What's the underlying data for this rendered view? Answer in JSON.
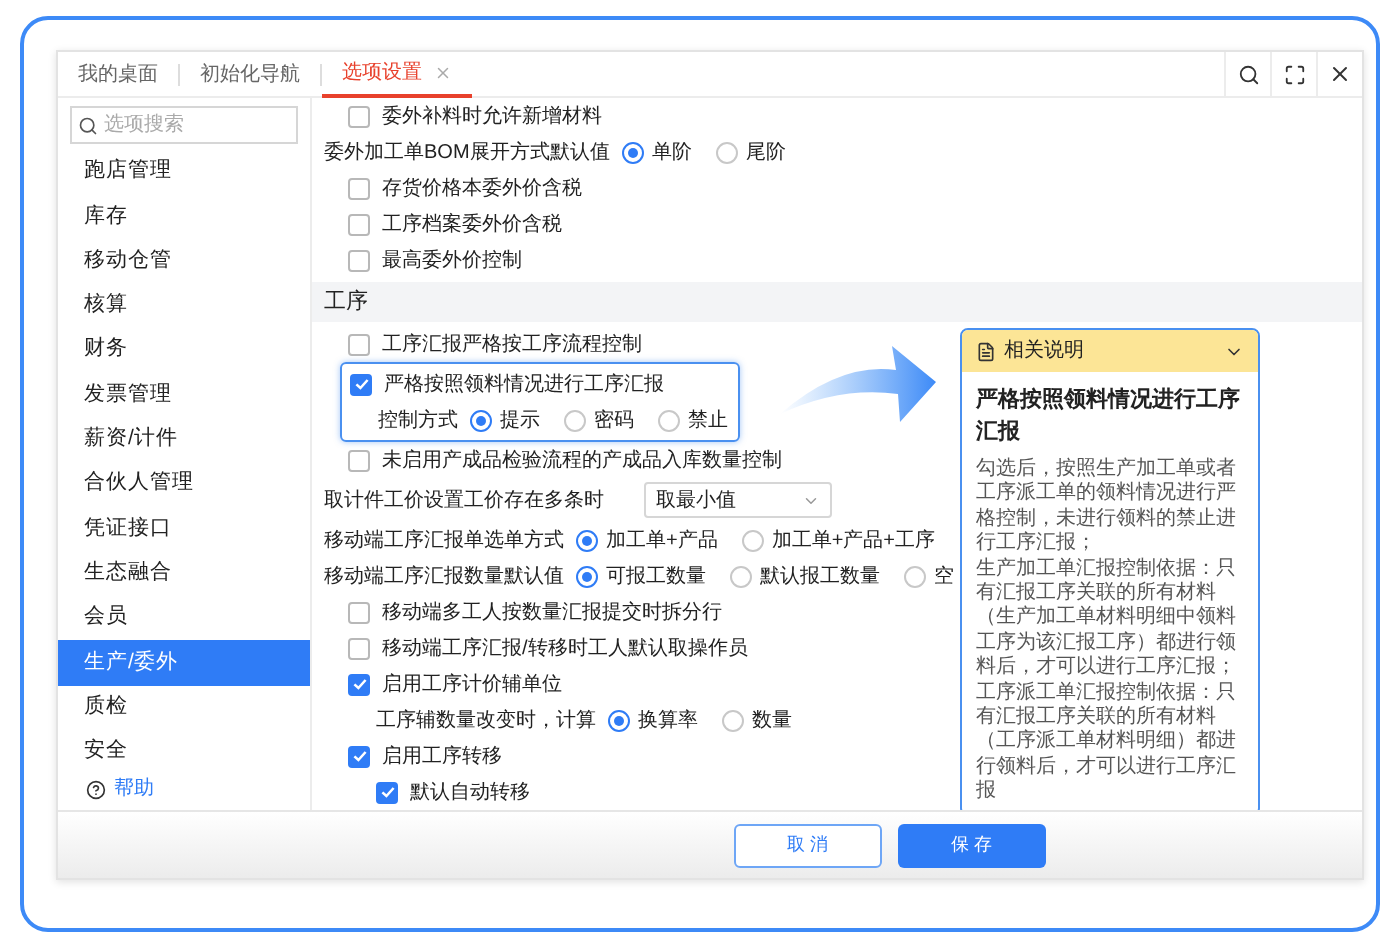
{
  "tabs": [
    {
      "label": "我的桌面",
      "selected": false
    },
    {
      "label": "初始化导航",
      "selected": false
    },
    {
      "label": "选项设置",
      "selected": true
    }
  ],
  "search": {
    "placeholder": "选项搜索"
  },
  "sidebar": {
    "items": [
      {
        "label": "跑店管理",
        "selected": false
      },
      {
        "label": "库存",
        "selected": false
      },
      {
        "label": "移动仓管",
        "selected": false
      },
      {
        "label": "核算",
        "selected": false
      },
      {
        "label": "财务",
        "selected": false
      },
      {
        "label": "发票管理",
        "selected": false
      },
      {
        "label": "薪资/计件",
        "selected": false
      },
      {
        "label": "合伙人管理",
        "selected": false
      },
      {
        "label": "凭证接口",
        "selected": false
      },
      {
        "label": "生态融合",
        "selected": false
      },
      {
        "label": "会员",
        "selected": false
      },
      {
        "label": "生产/委外",
        "selected": true
      },
      {
        "label": "质检",
        "selected": false
      },
      {
        "label": "安全",
        "selected": false
      }
    ],
    "help": "帮助"
  },
  "settings": [
    {
      "kind": "checkbox",
      "label": "委外补料时允许新增材料",
      "checked": false
    },
    {
      "kind": "radio",
      "label": "委外加工单BOM展开方式默认值",
      "options": [
        {
          "label": "单阶",
          "selected": true
        },
        {
          "label": "尾阶",
          "selected": false
        }
      ]
    },
    {
      "kind": "checkbox",
      "label": "存货价格本委外价含税",
      "checked": false
    },
    {
      "kind": "checkbox",
      "label": "工序档案委外价含税",
      "checked": false
    },
    {
      "kind": "checkbox",
      "label": "最高委外价控制",
      "checked": false
    },
    {
      "kind": "section",
      "label": "工序"
    },
    {
      "kind": "checkbox",
      "label": "工序汇报严格按工序流程控制",
      "checked": false
    },
    {
      "kind": "checkbox",
      "label": "严格按照领料情况进行工序汇报",
      "checked": true,
      "highlighted": true,
      "children": [
        {
          "kind": "radio",
          "label": "控制方式",
          "options": [
            {
              "label": "提示",
              "selected": true
            },
            {
              "label": "密码",
              "selected": false
            },
            {
              "label": "禁止",
              "selected": false
            }
          ]
        }
      ]
    },
    {
      "kind": "checkbox",
      "label": "未启用产成品检验流程的产成品入库数量控制",
      "checked": false
    },
    {
      "kind": "select",
      "label": "取计件工价设置工价存在多条时",
      "value": "取最小值"
    },
    {
      "kind": "radio",
      "label": "移动端工序汇报单选单方式",
      "options": [
        {
          "label": "加工单+产品",
          "selected": true
        },
        {
          "label": "加工单+产品+工序",
          "selected": false
        }
      ]
    },
    {
      "kind": "radio",
      "label": "移动端工序汇报数量默认值",
      "options": [
        {
          "label": "可报工数量",
          "selected": true
        },
        {
          "label": "默认报工数量",
          "selected": false
        },
        {
          "label": "空",
          "selected": false
        }
      ]
    },
    {
      "kind": "checkbox",
      "label": "移动端多工人按数量汇报提交时拆分行",
      "checked": false
    },
    {
      "kind": "checkbox",
      "label": "移动端工序汇报/转移时工人默认取操作员",
      "checked": false
    },
    {
      "kind": "checkbox",
      "label": "启用工序计价辅单位",
      "checked": true,
      "children": [
        {
          "kind": "radio",
          "label": "工序辅数量改变时，计算",
          "options": [
            {
              "label": "换算率",
              "selected": true
            },
            {
              "label": "数量",
              "selected": false
            }
          ]
        }
      ]
    },
    {
      "kind": "checkbox",
      "label": "启用工序转移",
      "checked": true,
      "children": [
        {
          "kind": "checkbox",
          "label": "默认自动转移",
          "checked": true
        }
      ]
    }
  ],
  "help_panel": {
    "header": "相关说明",
    "title": "严格按照领料情况进行工序汇报",
    "body": [
      "勾选后，按照生产加工单或者工序派工单的领料情况进行严格控制，未进行领料的禁止进行工序汇报；",
      "生产加工单汇报控制依据：只有汇报工序关联的所有材料（生产加工单材料明细中领料工序为该汇报工序）都进行领料后，才可以进行工序汇报；",
      "工序派工单汇报控制依据：只有汇报工序关联的所有材料（工序派工单材料明细）都进行领料后，才可以进行工序汇报"
    ]
  },
  "buttons": {
    "cancel": "取 消",
    "save": "保 存"
  }
}
